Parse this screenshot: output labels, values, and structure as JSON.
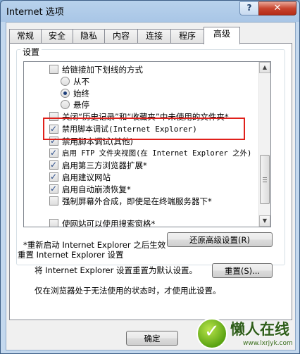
{
  "window": {
    "title": "Internet 选项",
    "help_label": "?",
    "close_label": "✕"
  },
  "tabs": [
    {
      "label": "常规"
    },
    {
      "label": "安全"
    },
    {
      "label": "隐私"
    },
    {
      "label": "内容"
    },
    {
      "label": "连接"
    },
    {
      "label": "程序"
    },
    {
      "label": "高级"
    }
  ],
  "active_tab": "高级",
  "settings": {
    "group_label": "设置",
    "items": [
      {
        "type": "checkbox",
        "checked": false,
        "label": "给链接加下划线的方式"
      },
      {
        "type": "radio",
        "checked": false,
        "label": "从不"
      },
      {
        "type": "radio",
        "checked": true,
        "label": "始终"
      },
      {
        "type": "radio",
        "checked": false,
        "label": "悬停"
      },
      {
        "type": "checkbox",
        "checked": false,
        "label": "关闭“历史记录”和“收藏夹”中未使用的文件夹*"
      },
      {
        "type": "checkbox",
        "checked": true,
        "label": "禁用脚本调试(Internet Explorer)"
      },
      {
        "type": "checkbox",
        "checked": true,
        "label": "禁用脚本调试(其他)"
      },
      {
        "type": "checkbox",
        "checked": true,
        "label": "启用 FTP 文件夹视图(在 Internet Explorer 之外)"
      },
      {
        "type": "checkbox",
        "checked": true,
        "label": "启用第三方浏览器扩展*"
      },
      {
        "type": "checkbox",
        "checked": true,
        "label": "启用建议网站"
      },
      {
        "type": "checkbox",
        "checked": true,
        "label": "启用自动崩溃恢复*"
      },
      {
        "type": "checkbox",
        "checked": false,
        "label": "强制屏幕外合成，即使是在终端服务器下*"
      },
      {
        "type": "checkbox",
        "checked": false,
        "label": "使网站可以使用搜索窗格*"
      }
    ],
    "restart_note": "*重新启动 Internet Explorer 之后生效",
    "restore_button": "还原高级设置(R)"
  },
  "reset": {
    "title": "重置 Internet Explorer 设置",
    "description": "将 Internet Explorer 设置重置为默认设置。",
    "button": "重置(S)...",
    "note": "仅在浏览器处于无法使用的状态时，才使用此设置。"
  },
  "footer": {
    "ok_button": "确定"
  },
  "watermark": {
    "brand": "懒人在线",
    "url": "www.lxrjyk.com"
  },
  "colors": {
    "highlight_box": "#e0201b",
    "close_button": "#c8442e"
  }
}
